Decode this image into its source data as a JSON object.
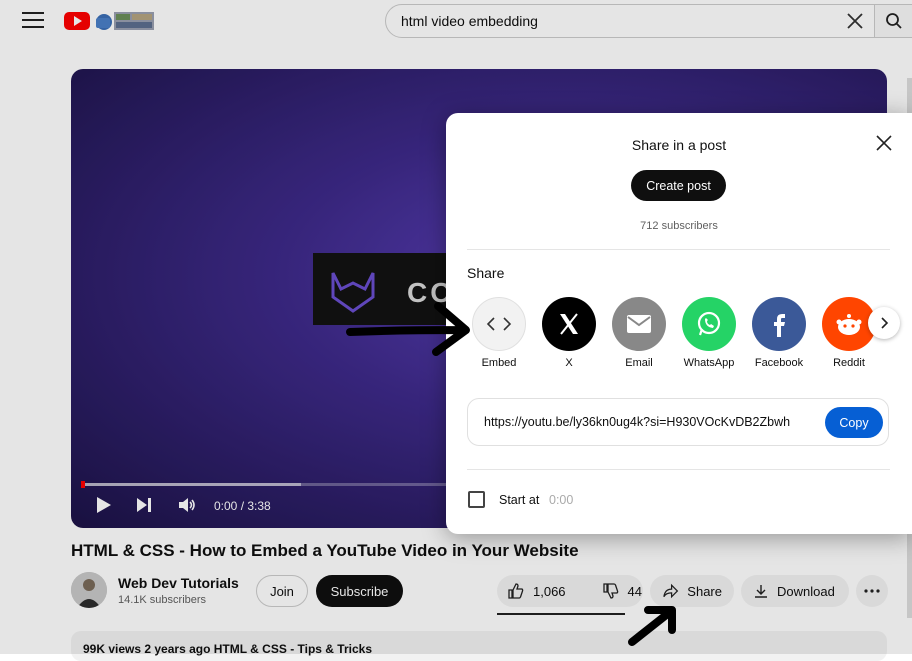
{
  "header": {
    "search_query": "html video embedding"
  },
  "player": {
    "brand_text": "CO",
    "time_display": "0:00 / 3:38"
  },
  "video": {
    "title": "HTML & CSS - How to Embed a YouTube Video in Your Website",
    "channel_name": "Web Dev Tutorials",
    "channel_subscribers": "14.1K subscribers",
    "join_label": "Join",
    "subscribe_label": "Subscribe",
    "like_count": "1,066",
    "dislike_count": "44",
    "share_label": "Share",
    "download_label": "Download",
    "description_meta": "99K views  2 years ago  HTML & CSS - Tips & Tricks"
  },
  "share_dialog": {
    "heading": "Share in a post",
    "create_post_label": "Create post",
    "subscribers": "712 subscribers",
    "share_section_label": "Share",
    "targets": [
      {
        "label": "Embed",
        "icon": "embed-icon",
        "color": "#f2f2f2"
      },
      {
        "label": "X",
        "icon": "x-icon",
        "color": "#000000"
      },
      {
        "label": "Email",
        "icon": "email-icon",
        "color": "#888888"
      },
      {
        "label": "WhatsApp",
        "icon": "whatsapp-icon",
        "color": "#25d366"
      },
      {
        "label": "Facebook",
        "icon": "facebook-icon",
        "color": "#3b5998"
      },
      {
        "label": "Reddit",
        "icon": "reddit-icon",
        "color": "#ff4500"
      }
    ],
    "url": "https://youtu.be/ly36kn0ug4k?si=H930VOcKvDB2Zbwh",
    "copy_label": "Copy",
    "start_at_label": "Start at",
    "start_at_value": "0:00"
  },
  "colors": {
    "subscribe_bg": "#0f0f0f",
    "copy_bg": "#065fd4",
    "progress_red": "#ff0000"
  }
}
